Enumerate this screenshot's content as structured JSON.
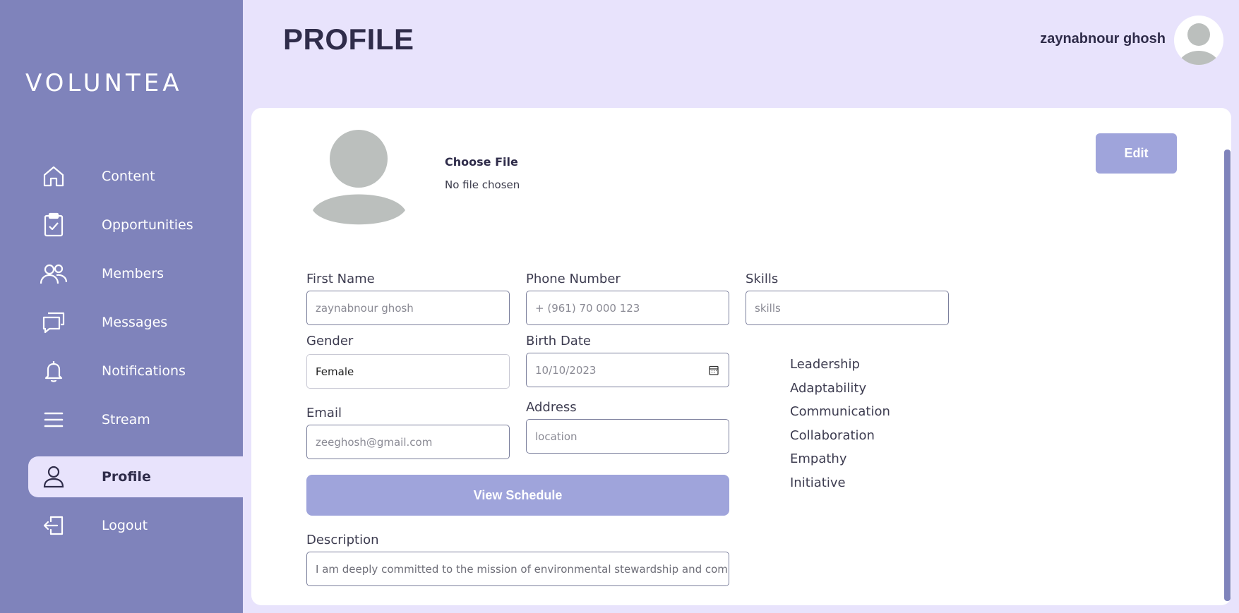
{
  "app": {
    "brand": "VOLUNTEA"
  },
  "sidebar": {
    "items": [
      {
        "label": "Content",
        "icon": "home-icon"
      },
      {
        "label": "Opportunities",
        "icon": "clipboard-check-icon"
      },
      {
        "label": "Members",
        "icon": "users-icon"
      },
      {
        "label": "Messages",
        "icon": "chat-icon"
      },
      {
        "label": "Notifications",
        "icon": "bell-icon"
      },
      {
        "label": "Stream",
        "icon": "menu-icon"
      },
      {
        "label": "Profile",
        "icon": "user-icon",
        "active": true
      },
      {
        "label": "Logout",
        "icon": "logout-icon"
      }
    ]
  },
  "header": {
    "title": "PROFILE",
    "user_name": "zaynabnour ghosh"
  },
  "profile": {
    "choose_file": "Choose File",
    "no_file": "No file chosen",
    "edit_label": "Edit"
  },
  "form": {
    "first_name": {
      "label": "First Name",
      "placeholder": "zaynabnour ghosh"
    },
    "phone": {
      "label": "Phone Number",
      "placeholder": "+ (961) 70 000 123"
    },
    "skills": {
      "label": "Skills",
      "placeholder": "skills"
    },
    "gender": {
      "label": "Gender",
      "value": "Female"
    },
    "birth_date": {
      "label": "Birth Date",
      "value": "10/10/2023"
    },
    "email": {
      "label": "Email",
      "placeholder": "zeeghosh@gmail.com"
    },
    "address": {
      "label": "Address",
      "placeholder": "location"
    },
    "view_schedule": "View Schedule",
    "description": {
      "label": "Description",
      "value": "I am deeply committed to the mission of environmental stewardship and community"
    }
  },
  "skills_list": [
    "Leadership",
    "Adaptability",
    "Communication",
    "Collaboration",
    "Empathy",
    "Initiative"
  ],
  "colors": {
    "sidebar": "#7f83bb",
    "page_bg": "#e8e3fc",
    "accent_button": "#9fa4db",
    "text_dark": "#2f2c4a"
  }
}
